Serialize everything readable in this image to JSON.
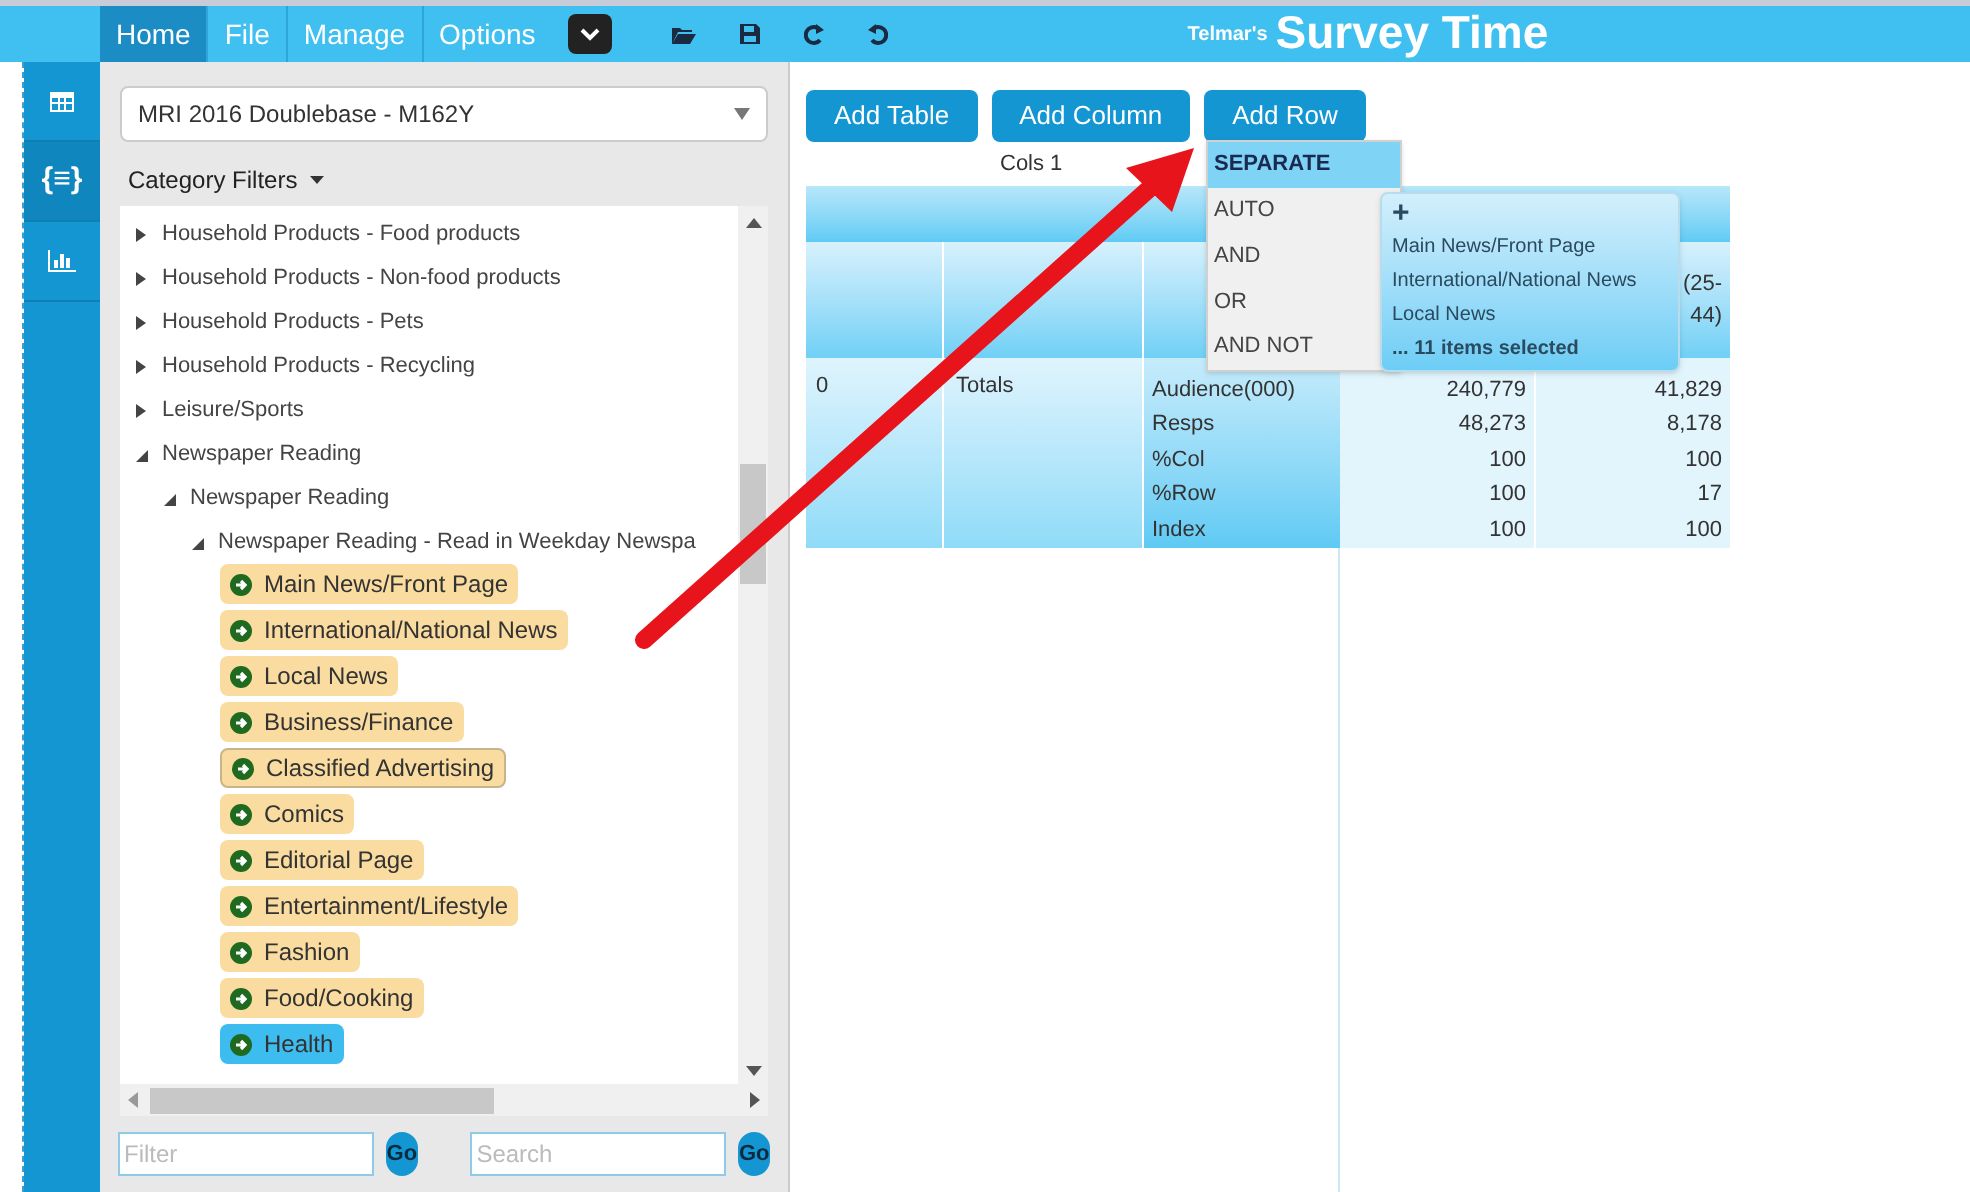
{
  "menu_bar": {
    "tabs": [
      {
        "label": "Home",
        "selected": true
      },
      {
        "label": "File",
        "selected": false
      },
      {
        "label": "Manage",
        "selected": false
      },
      {
        "label": "Options",
        "selected": false
      }
    ]
  },
  "app_title": {
    "prefix": "Telmar's",
    "name": "Survey Time"
  },
  "side_rail": [
    {
      "kind": "grid",
      "selected": false
    },
    {
      "kind": "text",
      "glyph": "{≡}",
      "selected": true
    },
    {
      "kind": "chart",
      "selected": false
    }
  ],
  "dataset_select": {
    "value": "MRI 2016 Doublebase - M162Y"
  },
  "category_filters": {
    "label": "Category Filters"
  },
  "tree": [
    {
      "label": "Household Products - Food products",
      "expanded": false
    },
    {
      "label": "Household Products - Non-food products",
      "expanded": false
    },
    {
      "label": "Household Products - Pets",
      "expanded": false
    },
    {
      "label": "Household Products - Recycling",
      "expanded": false
    },
    {
      "label": "Leisure/Sports",
      "expanded": false
    },
    {
      "label": "Newspaper Reading",
      "expanded": true,
      "children": [
        {
          "label": "Newspaper Reading",
          "expanded": true,
          "children": [
            {
              "label": "Newspaper Reading - Read in Weekday Newspa",
              "expanded": true,
              "children": [
                {
                  "kind": "chip",
                  "label": "Main News/Front Page",
                  "selected": false,
                  "focused": false
                },
                {
                  "kind": "chip",
                  "label": "International/National News",
                  "selected": false,
                  "focused": false
                },
                {
                  "kind": "chip",
                  "label": "Local News",
                  "selected": false,
                  "focused": false
                },
                {
                  "kind": "chip",
                  "label": "Business/Finance",
                  "selected": false,
                  "focused": false
                },
                {
                  "kind": "chip",
                  "label": "Classified Advertising",
                  "selected": false,
                  "focused": true
                },
                {
                  "kind": "chip",
                  "label": "Comics",
                  "selected": false,
                  "focused": false
                },
                {
                  "kind": "chip",
                  "label": "Editorial Page",
                  "selected": false,
                  "focused": false
                },
                {
                  "kind": "chip",
                  "label": "Entertainment/Lifestyle",
                  "selected": false,
                  "focused": false
                },
                {
                  "kind": "chip",
                  "label": "Fashion",
                  "selected": false,
                  "focused": false
                },
                {
                  "kind": "chip",
                  "label": "Food/Cooking",
                  "selected": false,
                  "focused": false
                },
                {
                  "kind": "chip",
                  "label": "Health",
                  "selected": true,
                  "focused": false
                }
              ]
            }
          ]
        }
      ]
    }
  ],
  "filter_field": {
    "placeholder": "Filter",
    "button": "Go"
  },
  "search_field": {
    "placeholder": "Search",
    "button": "Go"
  },
  "toolbar": {
    "buttons": [
      "Add Table",
      "Add Column",
      "Add Row"
    ],
    "cols_count": "Cols 1"
  },
  "table": {
    "column_5_header": [
      "(25-",
      "44)"
    ],
    "row": {
      "column_1": "0",
      "column_2": "Totals"
    },
    "metrics": [
      {
        "label": "Audience(000)",
        "values": [
          "240,779",
          "41,829"
        ]
      },
      {
        "label": "Resps",
        "values": [
          "48,273",
          "8,178"
        ]
      },
      {
        "label": "%Col",
        "values": [
          "100",
          "100"
        ]
      },
      {
        "label": "%Row",
        "values": [
          "100",
          "17"
        ]
      },
      {
        "label": "Index",
        "values": [
          "100",
          "100"
        ]
      }
    ]
  },
  "combine_menu": [
    {
      "label": "SEPARATE",
      "selected": true
    },
    {
      "label": "AUTO",
      "selected": false
    },
    {
      "label": "AND",
      "selected": false
    },
    {
      "label": "OR",
      "selected": false
    },
    {
      "label": "AND NOT",
      "selected": false
    }
  ],
  "selection_tooltip": {
    "plus": "+",
    "items": [
      "Main News/Front Page",
      "International/National News",
      "Local News"
    ],
    "summary": "... 11 items selected"
  }
}
